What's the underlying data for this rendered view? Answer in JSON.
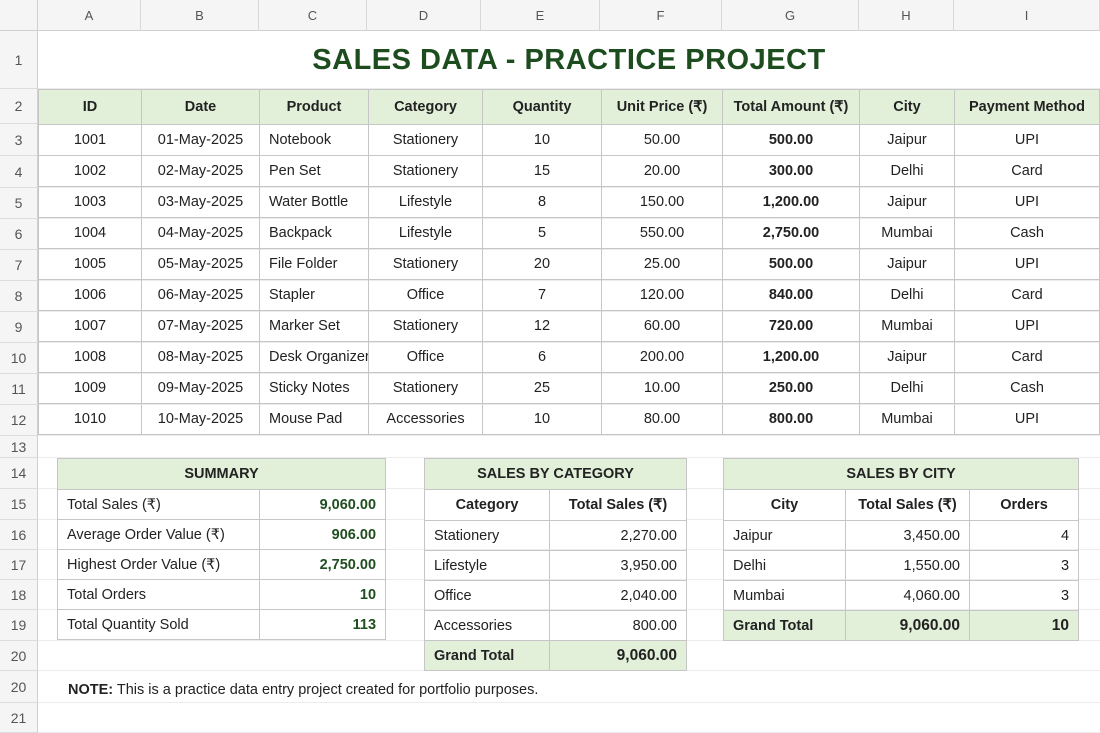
{
  "columns": [
    "A",
    "B",
    "C",
    "D",
    "E",
    "F",
    "G",
    "H",
    "I"
  ],
  "rows": [
    "1",
    "2",
    "3",
    "4",
    "5",
    "6",
    "7",
    "8",
    "9",
    "10",
    "11",
    "12",
    "13",
    "14",
    "15",
    "16",
    "17",
    "18",
    "19",
    "20",
    "20",
    "21"
  ],
  "title": "SALES DATA - PRACTICE PROJECT",
  "sales": {
    "headers": [
      "ID",
      "Date",
      "Product",
      "Category",
      "Quantity",
      "Unit Price (₹)",
      "Total Amount (₹)",
      "City",
      "Payment Method"
    ],
    "rows": [
      [
        "1001",
        "01-May-2025",
        "Notebook",
        "Stationery",
        "10",
        "50.00",
        "500.00",
        "Jaipur",
        "UPI"
      ],
      [
        "1002",
        "02-May-2025",
        "Pen Set",
        "Stationery",
        "15",
        "20.00",
        "300.00",
        "Delhi",
        "Card"
      ],
      [
        "1003",
        "03-May-2025",
        "Water Bottle",
        "Lifestyle",
        "8",
        "150.00",
        "1,200.00",
        "Jaipur",
        "UPI"
      ],
      [
        "1004",
        "04-May-2025",
        "Backpack",
        "Lifestyle",
        "5",
        "550.00",
        "2,750.00",
        "Mumbai",
        "Cash"
      ],
      [
        "1005",
        "05-May-2025",
        "File Folder",
        "Stationery",
        "20",
        "25.00",
        "500.00",
        "Jaipur",
        "UPI"
      ],
      [
        "1006",
        "06-May-2025",
        "Stapler",
        "Office",
        "7",
        "120.00",
        "840.00",
        "Delhi",
        "Card"
      ],
      [
        "1007",
        "07-May-2025",
        "Marker Set",
        "Stationery",
        "12",
        "60.00",
        "720.00",
        "Mumbai",
        "UPI"
      ],
      [
        "1008",
        "08-May-2025",
        "Desk Organizer",
        "Office",
        "6",
        "200.00",
        "1,200.00",
        "Jaipur",
        "Card"
      ],
      [
        "1009",
        "09-May-2025",
        "Sticky Notes",
        "Stationery",
        "25",
        "10.00",
        "250.00",
        "Delhi",
        "Cash"
      ],
      [
        "1010",
        "10-May-2025",
        "Mouse Pad",
        "Accessories",
        "10",
        "80.00",
        "800.00",
        "Mumbai",
        "UPI"
      ]
    ]
  },
  "summary": {
    "title": "SUMMARY",
    "rows": [
      [
        "Total Sales (₹)",
        "9,060.00"
      ],
      [
        "Average Order Value (₹)",
        "906.00"
      ],
      [
        "Highest Order Value (₹)",
        "2,750.00"
      ],
      [
        "Total Orders",
        "10"
      ],
      [
        "Total Quantity Sold",
        "113"
      ]
    ]
  },
  "by_category": {
    "title": "SALES BY CATEGORY",
    "headers": [
      "Category",
      "Total Sales (₹)"
    ],
    "rows": [
      [
        "Stationery",
        "2,270.00"
      ],
      [
        "Lifestyle",
        "3,950.00"
      ],
      [
        "Office",
        "2,040.00"
      ],
      [
        "Accessories",
        "800.00"
      ]
    ],
    "total_label": "Grand Total",
    "total_value": "9,060.00"
  },
  "by_city": {
    "title": "SALES BY CITY",
    "headers": [
      "City",
      "Total Sales (₹)",
      "Orders"
    ],
    "rows": [
      [
        "Jaipur",
        "3,450.00",
        "4"
      ],
      [
        "Delhi",
        "1,550.00",
        "3"
      ],
      [
        "Mumbai",
        "4,060.00",
        "3"
      ]
    ],
    "total_label": "Grand Total",
    "total_value": "9,060.00",
    "total_orders": "10"
  },
  "note": {
    "label": "NOTE:",
    "text": " This is a practice data entry project created for portfolio purposes."
  },
  "colors": {
    "header_fill": "#e2f0d9",
    "title_text": "#1d4d1f"
  }
}
